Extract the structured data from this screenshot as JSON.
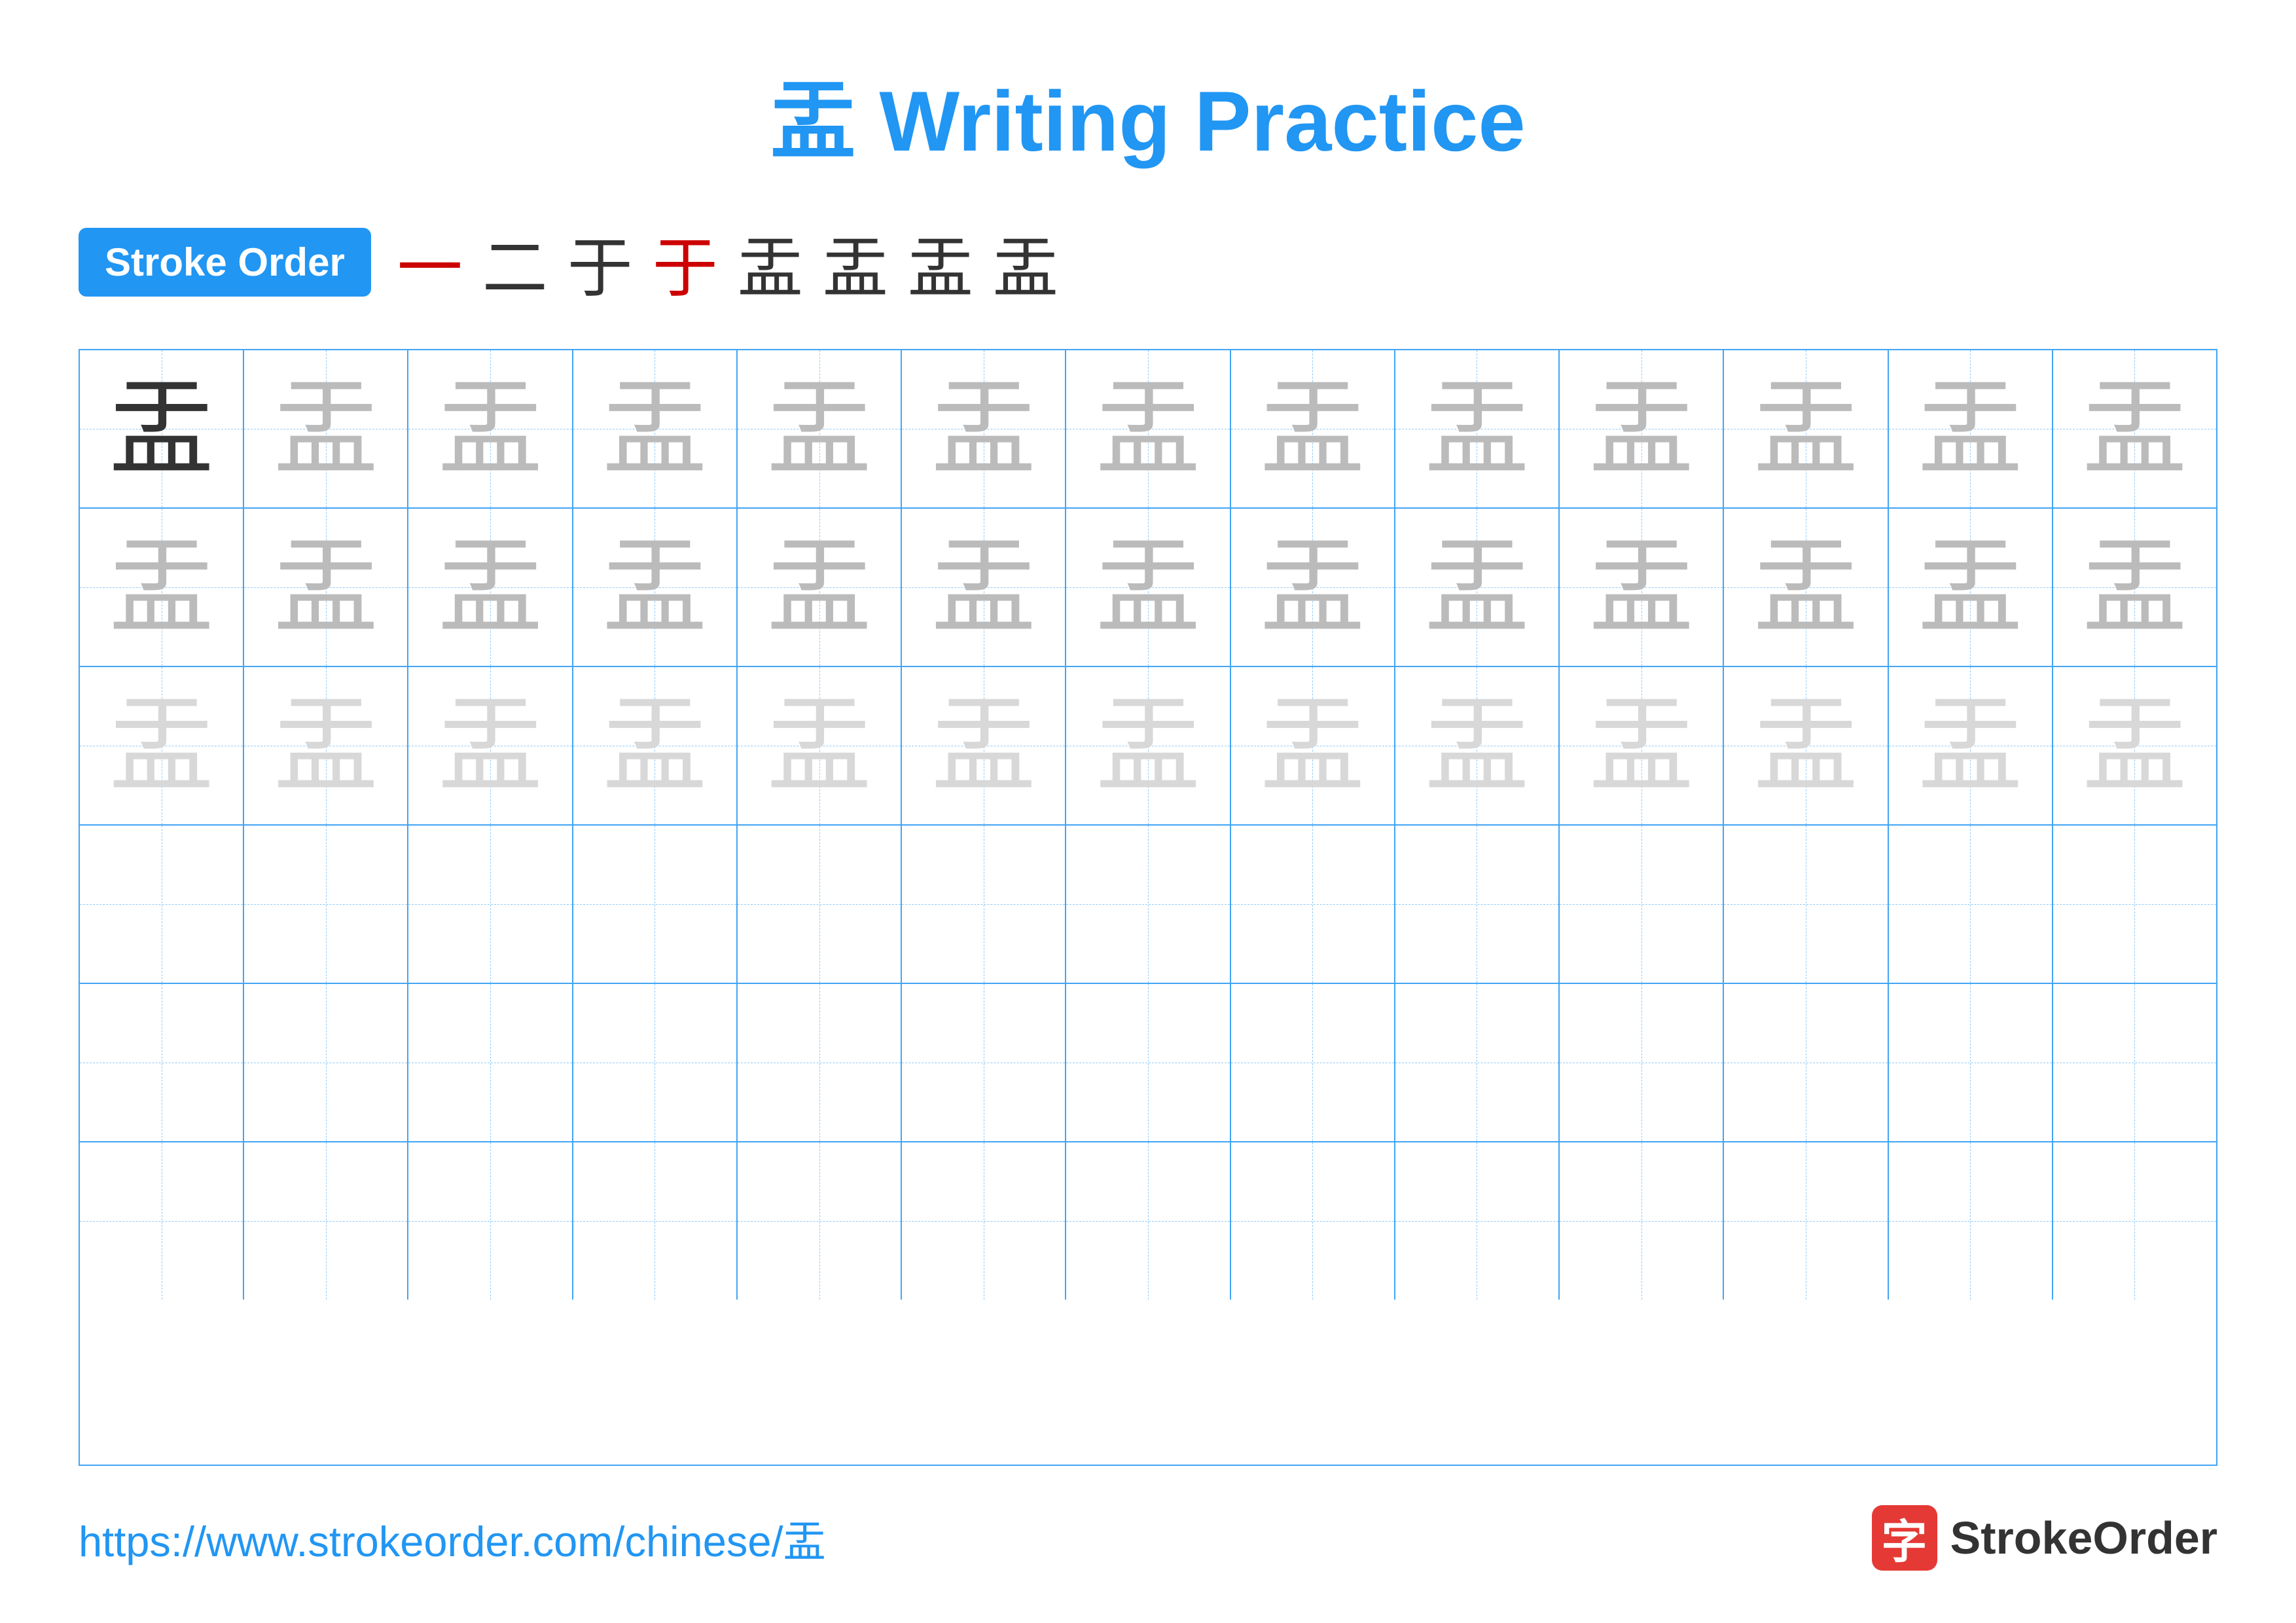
{
  "page": {
    "title": "盂 Writing Practice",
    "title_char": "盂",
    "title_text": " Writing Practice",
    "stroke_order_label": "Stroke Order",
    "stroke_sequence": [
      "一",
      "二",
      "于",
      "于",
      "盂",
      "盂",
      "盂",
      "盂"
    ],
    "url": "https://www.strokeorder.com/chinese/盂",
    "logo_text": "StrokeOrder",
    "logo_icon": "字",
    "main_char": "盂",
    "grid": {
      "rows": 6,
      "cols": 13,
      "row_styles": [
        "dark-first-medium-rest",
        "medium",
        "light",
        "empty",
        "empty",
        "empty"
      ]
    }
  }
}
